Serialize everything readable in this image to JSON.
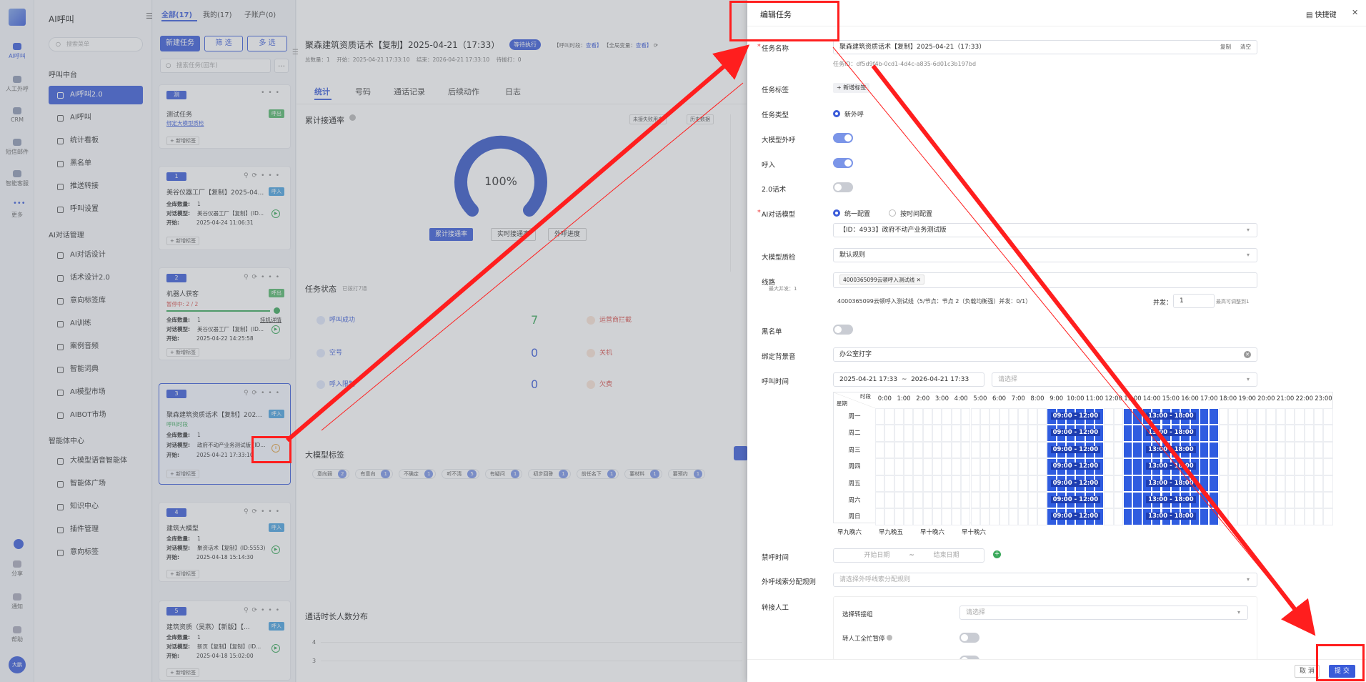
{
  "rail": {
    "items": [
      "AI呼叫",
      "人工外呼",
      "CRM",
      "短信邮件",
      "智能客服",
      "更多"
    ],
    "bottom": [
      "分享",
      "通知",
      "帮助"
    ],
    "avatar": "大鹏"
  },
  "sidebar": {
    "title": "AI呼叫",
    "search_placeholder": "搜索菜单",
    "section1": "呼叫中台",
    "items1": [
      "AI呼叫2.0",
      "AI呼叫",
      "统计看板",
      "黑名单",
      "推送转接",
      "呼叫设置"
    ],
    "section2": "AI对话管理",
    "items2": [
      "AI对话设计",
      "话术设计2.0",
      "意向标签库",
      "AI训练",
      "案例音频",
      "智能词典",
      "AI模型市场",
      "AIBOT市场"
    ],
    "section3": "智能体中心",
    "items3": [
      "大模型语音智能体",
      "智能体广场",
      "知识中心",
      "插件管理",
      "意向标签"
    ]
  },
  "tasklist": {
    "tabs": [
      "全部(17)",
      "我的(17)",
      "子账户(0)"
    ],
    "buttons": [
      "新建任务",
      "筛 选",
      "多 选"
    ],
    "search_placeholder": "搜索任务(回车)",
    "add_tag": "+ 新增标签",
    "cards": [
      {
        "num": "测",
        "title": "测试任务",
        "badge": "呼出",
        "link": "绑定大模型质检"
      },
      {
        "num": "1",
        "title": "美谷仪器工厂【复制】2025-04...",
        "badge": "呼入",
        "l1": "1",
        "l2": "美谷仪器工厂【复制】(ID...",
        "l3": "2025-04-24 11:06:31"
      },
      {
        "num": "2",
        "title": "机器人获客",
        "badge": "呼出",
        "status": "暂停中: 2 / 2",
        "detail": "挂机详情",
        "l1": "1",
        "l2": "美谷仪器工厂【复制】(ID...",
        "l3": "2025-04-22 14:25:58"
      },
      {
        "num": "3",
        "title": "聚森建筑资质话术【复制】202...",
        "badge": "呼入",
        "status": "呼叫时段",
        "l1": "1",
        "l2": "政府不动产业务测试版 (ID...",
        "l3": "2025-04-21 17:33:10"
      },
      {
        "num": "4",
        "title": "建筑大模型",
        "badge": "呼入",
        "l1": "1",
        "l2": "聚资话术【复制】(ID:5553)",
        "l3": "2025-04-18 15:14:30"
      },
      {
        "num": "5",
        "title": "建筑资质（吴燕）【新版】【...",
        "badge": "呼入",
        "l1": "1",
        "l2": "新页【复制】【复制】(ID...",
        "l3": "2025-04-18 15:02:00"
      }
    ],
    "labels": {
      "total": "全库数量:",
      "script": "对话模型:",
      "start": "开始:"
    }
  },
  "main": {
    "title": "聚森建筑资质话术【复制】2025-04-21（17:33）",
    "status": "等待执行",
    "meta1": "【呼叫时段：",
    "meta1v": "查看】",
    "meta2": "【全局变量：",
    "meta2v": "查看】",
    "sub": "总数量：1    开始：2025-04-21 17:33:10    结束：2026-04-21 17:33:10    待拨打：0",
    "tabs": [
      "统计",
      "号码",
      "通话记录",
      "后续动作",
      "日志"
    ],
    "rate_title": "累计接通率",
    "rate_btns": [
      "未接失败用户",
      "历史数据"
    ],
    "gauge": "100%",
    "gauge_tabs": [
      "累计接通率",
      "实时接通率",
      "外呼进度"
    ],
    "status_title": "任务状态",
    "status_sub": "已拨打7通",
    "stats": [
      {
        "label": "呼叫成功",
        "value": "7"
      },
      {
        "label": "空号",
        "value": "0"
      },
      {
        "label": "呼入限制",
        "value": "0"
      }
    ],
    "stats2": [
      "运营商拦截",
      "关机",
      "欠费"
    ],
    "llm_title": "大模型标签",
    "llm_tags": [
      {
        "t": "意向弱",
        "n": "2"
      },
      {
        "t": "有意向",
        "n": "1"
      },
      {
        "t": "不确定",
        "n": "1"
      },
      {
        "t": "听不清",
        "n": "5"
      },
      {
        "t": "有疑问",
        "n": "1"
      },
      {
        "t": "初步回答",
        "n": "1"
      },
      {
        "t": "前任名下",
        "n": "1"
      },
      {
        "t": "要材料",
        "n": "1"
      },
      {
        "t": "要预约",
        "n": "1"
      }
    ],
    "dist_title": "通话时长人数分布",
    "ticks": [
      "4",
      "3"
    ]
  },
  "drawer": {
    "title": "编辑任务",
    "shortcut": "快捷键",
    "close": "✕",
    "name_label": "任务名称",
    "name_value": "聚森建筑资质话术【复制】2025-04-21（17:33）",
    "copy": "复制",
    "clear": "清空",
    "task_id": "任务ID：df5d9f4b-0cd1-4d4c-a835-6d01c3b197bd",
    "tag_label": "任务标签",
    "tag_add": "+ 新增标签",
    "type_label": "任务类型",
    "type_value": "新外呼",
    "llm_call_label": "大模型外呼",
    "inbound_label": "呼入",
    "script2_label": "2.0话术",
    "model_label": "AI对话模型",
    "model_opt1": "统一配置",
    "model_opt2": "按时间配置",
    "model_value": "【ID：4933】政府不动产业务测试版",
    "qc_label": "大模型质检",
    "qc_value": "默认规则",
    "line_label": "线路",
    "line_sub": "最大并发：1",
    "line_tag": "4000365099云顿呼入测试线 ✕",
    "line_info": "4000365099云顿呼入测试线（5/节点：节点 2（负载均衡强）并发：0/1）",
    "concurrency_label": "并发：",
    "concurrency_value": "1",
    "concurrency_hint": "最高可调整到1",
    "blacklist_label": "黑名单",
    "bgsound_label": "绑定背景音",
    "bgsound_value": "办公室打字",
    "calltime_label": "呼叫时间",
    "date_range": "2025-04-21 17:33  ~  2026-04-21 17:33",
    "calltime_ph": "请选择",
    "sched_corner_top": "时段",
    "sched_corner_bottom": "星期",
    "hours": [
      "0:00",
      "1:00",
      "2:00",
      "3:00",
      "4:00",
      "5:00",
      "6:00",
      "7:00",
      "8:00",
      "9:00",
      "10:00",
      "11:00",
      "12:00",
      "13:00",
      "14:00",
      "15:00",
      "16:00",
      "17:00",
      "18:00",
      "19:00",
      "20:00",
      "21:00",
      "22:00",
      "23:00"
    ],
    "days": [
      "周一",
      "周二",
      "周三",
      "周四",
      "周五",
      "周六",
      "周日"
    ],
    "slot1": "09:00 - 12:00",
    "slot2": "13:00 - 18:00",
    "presets": [
      "早九晚六",
      "早九晚五",
      "早十晚六",
      "早十晚六"
    ],
    "forbid_label": "禁呼时间",
    "forbid_start": "开始日期",
    "forbid_sep": "~",
    "forbid_end": "结束日期",
    "assign_label": "外呼线索分配规则",
    "assign_ph": "请选择外呼线索分配规则",
    "transfer_label": "转接人工",
    "transfer_group_label": "选择转接组",
    "transfer_group_ph": "请选择",
    "transfer_busy_label": "转人工全忙暂停",
    "cancel": "取 消",
    "submit": "提 交"
  },
  "colors": {
    "accent": "#3a5bd9",
    "slot": "#2f5ce0",
    "annotation": "#ff1e1e"
  }
}
